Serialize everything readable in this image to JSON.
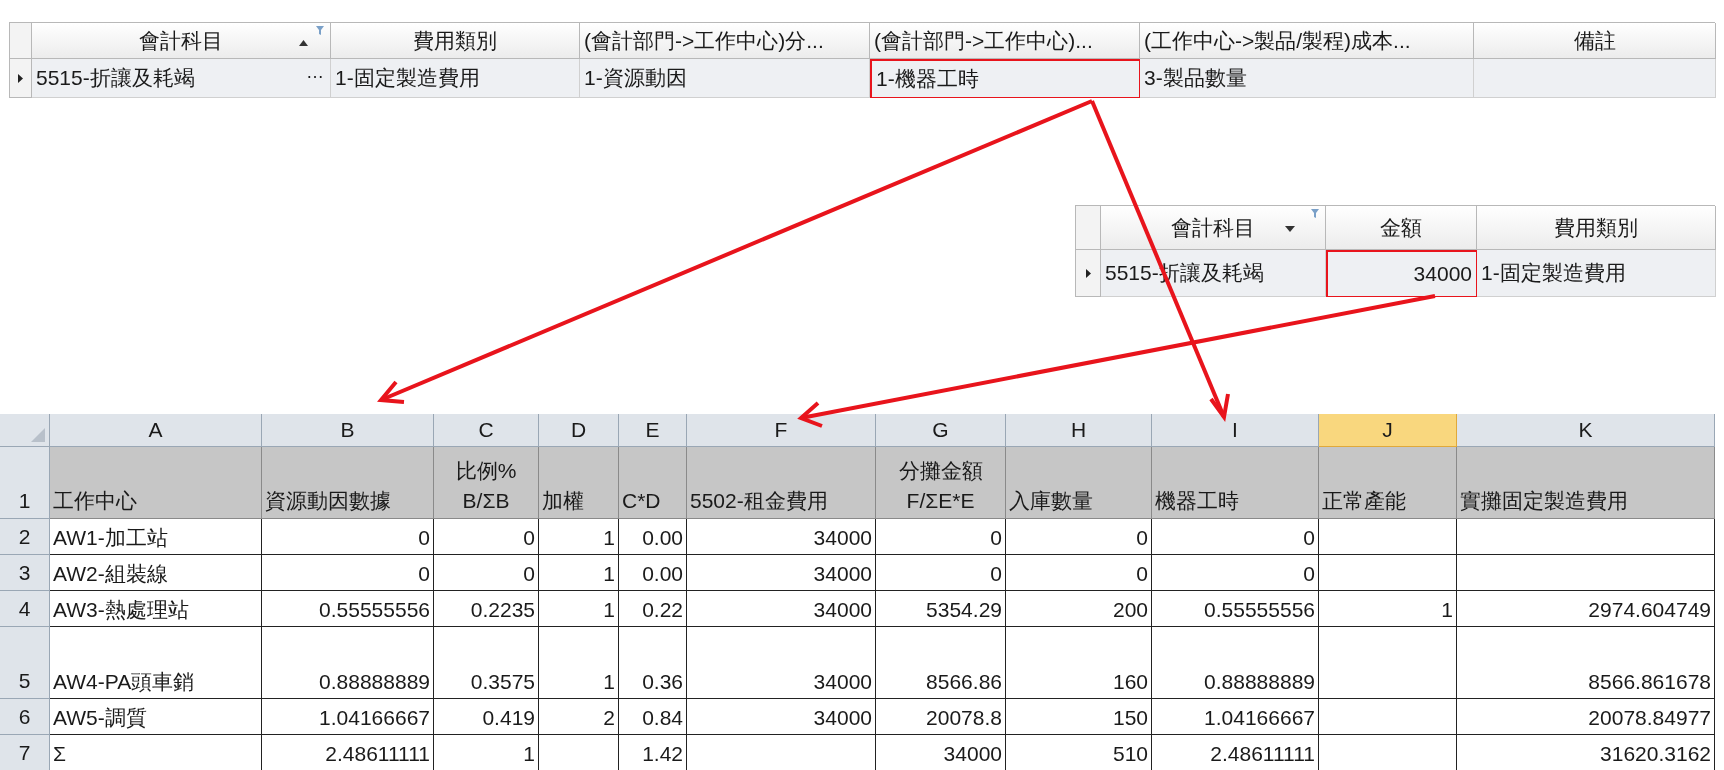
{
  "top_grid": {
    "columns": [
      {
        "label": "會計科目",
        "sorted_ascending": true,
        "dropdown": false,
        "filtered": true
      },
      {
        "label": "費用類別",
        "sorted_ascending": false,
        "dropdown": false,
        "filtered": false
      },
      {
        "label": "(會計部門->工作中心)分...",
        "sorted_ascending": false,
        "dropdown": false,
        "filtered": false
      },
      {
        "label": "(會計部門->工作中心)...",
        "sorted_ascending": false,
        "dropdown": false,
        "filtered": false
      },
      {
        "label": "(工作中心->製品/製程)成本...",
        "sorted_ascending": false,
        "dropdown": false,
        "filtered": false
      },
      {
        "label": "備註",
        "sorted_ascending": false,
        "dropdown": false,
        "filtered": false
      }
    ],
    "rows": [
      {
        "current": true,
        "cells": [
          {
            "text": "5515-折讓及耗竭",
            "highlighted": false,
            "ellipsis": "…"
          },
          {
            "text": "1-固定製造費用",
            "highlighted": false
          },
          {
            "text": "1-資源動因",
            "highlighted": false
          },
          {
            "text": "1-機器工時",
            "highlighted": true
          },
          {
            "text": "3-製品數量",
            "highlighted": false
          },
          {
            "text": null,
            "highlighted": false
          }
        ]
      }
    ]
  },
  "amount_grid": {
    "columns": [
      {
        "label": "會計科目",
        "sorted_ascending": false,
        "dropdown": true,
        "filtered": true
      },
      {
        "label": "金額",
        "sorted_ascending": false,
        "dropdown": false,
        "filtered": false
      },
      {
        "label": "費用類別",
        "sorted_ascending": false,
        "dropdown": false,
        "filtered": false
      }
    ],
    "rows": [
      {
        "current": true,
        "cells": [
          {
            "text": "5515-折讓及耗竭",
            "highlighted": false
          },
          {
            "text": "34000",
            "highlighted": true
          },
          {
            "text": "1-固定製造費用",
            "highlighted": false
          }
        ]
      }
    ]
  },
  "spreadsheet": {
    "columns": [
      {
        "label": "A",
        "selected": false
      },
      {
        "label": "B",
        "selected": false
      },
      {
        "label": "C",
        "selected": false
      },
      {
        "label": "D",
        "selected": false
      },
      {
        "label": "E",
        "selected": false
      },
      {
        "label": "F",
        "selected": false
      },
      {
        "label": "G",
        "selected": false
      },
      {
        "label": "H",
        "selected": false
      },
      {
        "label": "I",
        "selected": false
      },
      {
        "label": "J",
        "selected": true
      },
      {
        "label": "K",
        "selected": false
      }
    ],
    "rows": [
      {
        "number": "1",
        "kind": "header",
        "cells": [
          [
            "工作中心"
          ],
          [
            "資源動因數據"
          ],
          [
            "比例%",
            "B/ΣB"
          ],
          [
            "加權"
          ],
          [
            "C*D"
          ],
          [
            "5502-租金費用"
          ],
          [
            "分攤金額",
            "F/ΣE*E"
          ],
          [
            "入庫數量"
          ],
          [
            "機器工時"
          ],
          [
            "正常產能"
          ],
          [
            "實攤固定製造費用"
          ]
        ]
      },
      {
        "number": "2",
        "kind": "data",
        "cells": [
          "AW1-加工站",
          "0",
          "0",
          "1",
          "0.00",
          "34000",
          "0",
          "0",
          "0",
          null,
          null
        ]
      },
      {
        "number": "3",
        "kind": "data",
        "cells": [
          "AW2-組裝線",
          "0",
          "0",
          "1",
          "0.00",
          "34000",
          "0",
          "0",
          "0",
          null,
          null
        ]
      },
      {
        "number": "4",
        "kind": "data",
        "cells": [
          "AW3-熱處理站",
          "0.55555556",
          "0.2235",
          "1",
          "0.22",
          "34000",
          "5354.29",
          "200",
          "0.55555556",
          "1",
          "2974.604749"
        ]
      },
      {
        "number": "5",
        "kind": "data",
        "cells": [
          "AW4-PA頭車銷",
          "0.88888889",
          "0.3575",
          "1",
          "0.36",
          "34000",
          "8566.86",
          "160",
          "0.88888889",
          null,
          "8566.861678"
        ]
      },
      {
        "number": "6",
        "kind": "data",
        "cells": [
          "AW5-調質",
          "1.04166667",
          "0.419",
          "2",
          "0.84",
          "34000",
          "20078.8",
          "150",
          "1.04166667",
          null,
          "20078.84977"
        ]
      },
      {
        "number": "7",
        "kind": "data",
        "cells": [
          "Σ",
          "2.48611111",
          "1",
          null,
          "1.42",
          null,
          "34000",
          "510",
          "2.48611111",
          null,
          "31620.3162"
        ]
      }
    ]
  }
}
